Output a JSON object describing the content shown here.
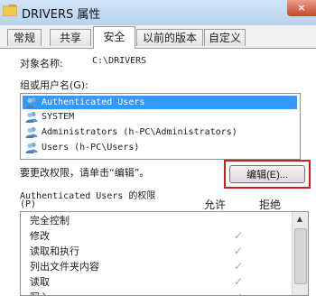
{
  "window": {
    "title": "DRIVERS 属性",
    "close_label": "×"
  },
  "tabs": [
    {
      "label": "常规",
      "active": false
    },
    {
      "label": "共享",
      "active": false
    },
    {
      "label": "安全",
      "active": true
    },
    {
      "label": "以前的版本",
      "active": false
    },
    {
      "label": "自定义",
      "active": false
    }
  ],
  "security": {
    "object_label": "对象名称:",
    "object_value": "C:\\DRIVERS",
    "groups_label": "组或用户名(G):",
    "users": [
      {
        "name": "Authenticated Users",
        "selected": true,
        "icon": "users-group-icon"
      },
      {
        "name": "SYSTEM",
        "selected": false,
        "icon": "users-group-icon"
      },
      {
        "name": "Administrators (h-PC\\Administrators)",
        "selected": false,
        "icon": "users-group-icon"
      },
      {
        "name": "Users (h-PC\\Users)",
        "selected": false,
        "icon": "users-group-icon"
      }
    ],
    "change_hint": "要更改权限，请单击“编辑”。",
    "edit_button": "编辑(E)...",
    "perm_title": "Authenticated Users 的权限",
    "perm_p": "(P)",
    "allow_label": "允许",
    "deny_label": "拒绝",
    "permissions": [
      {
        "name": "完全控制",
        "allow": false,
        "deny": false
      },
      {
        "name": "修改",
        "allow": true,
        "deny": false
      },
      {
        "name": "读取和执行",
        "allow": true,
        "deny": false
      },
      {
        "name": "列出文件夹内容",
        "allow": true,
        "deny": false
      },
      {
        "name": "读取",
        "allow": true,
        "deny": false
      },
      {
        "name": "写入",
        "allow": true,
        "deny": false
      }
    ],
    "check_glyph": "✓",
    "selected_color": "#3399ff",
    "highlight_color": "#d21b1b"
  }
}
